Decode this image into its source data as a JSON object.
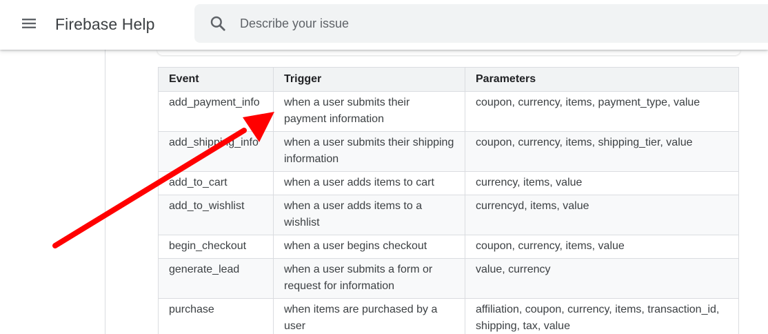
{
  "header": {
    "app_title": "Firebase Help",
    "menu_icon": "menu-icon",
    "search": {
      "icon": "search-icon",
      "placeholder": "Describe your issue",
      "value": ""
    }
  },
  "table": {
    "columns": [
      "Event",
      "Trigger",
      "Parameters"
    ],
    "rows": [
      {
        "event": "add_payment_info",
        "trigger": "when a user submits their payment information",
        "parameters": "coupon, currency, items, payment_type, value"
      },
      {
        "event": "add_shipping_info",
        "trigger": "when a user submits their shipping information",
        "parameters": "coupon, currency, items, shipping_tier, value"
      },
      {
        "event": "add_to_cart",
        "trigger": "when a user adds items to cart",
        "parameters": "currency, items, value"
      },
      {
        "event": "add_to_wishlist",
        "trigger": "when a user adds items to a wishlist",
        "parameters": "currencyd, items, value"
      },
      {
        "event": "begin_checkout",
        "trigger": "when a user begins checkout",
        "parameters": "coupon, currency, items, value"
      },
      {
        "event": "generate_lead",
        "trigger": "when a user submits a form or request for information",
        "parameters": "value, currency"
      },
      {
        "event": "purchase",
        "trigger": "when items are purchased by a user",
        "parameters": "affiliation, coupon, currency, items, transaction_id, shipping, tax, value"
      }
    ]
  },
  "annotation": {
    "color": "#ff0000",
    "icon": "red-arrow-annotation"
  }
}
